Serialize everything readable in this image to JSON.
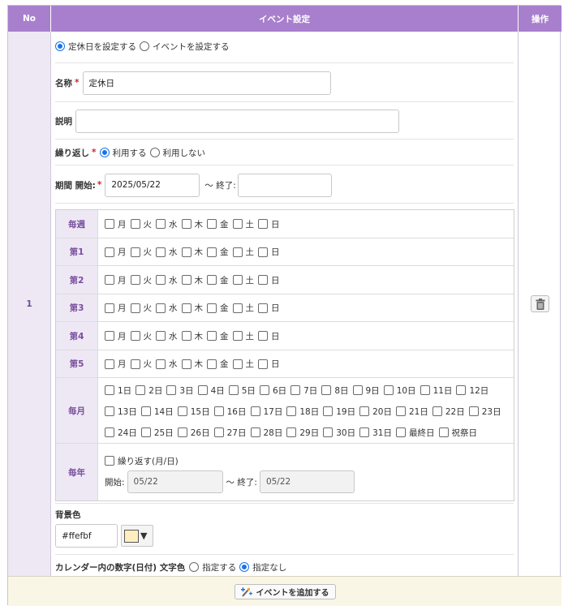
{
  "headers": {
    "no": "No",
    "event": "イベント設定",
    "ops": "操作"
  },
  "row_no": "1",
  "type_options": [
    {
      "label": "定休日を設定する",
      "selected": true
    },
    {
      "label": "イベントを設定する",
      "selected": false
    }
  ],
  "name": {
    "label": "名称",
    "required_mark": "*",
    "value": "定休日"
  },
  "description": {
    "label": "説明",
    "value": ""
  },
  "repeat": {
    "label": "繰り返し",
    "required_mark": "*",
    "options": [
      {
        "label": "利用する",
        "selected": true
      },
      {
        "label": "利用しない",
        "selected": false
      }
    ]
  },
  "period": {
    "label": "期間 開始:",
    "required_mark": "*",
    "start": "2025/05/22",
    "end_label": "〜 終了:",
    "end": ""
  },
  "weekdays": [
    "月",
    "火",
    "水",
    "木",
    "金",
    "土",
    "日"
  ],
  "week_rows": [
    "毎週",
    "第1",
    "第2",
    "第3",
    "第4",
    "第5"
  ],
  "monthly": {
    "label": "毎月",
    "days": [
      "1日",
      "2日",
      "3日",
      "4日",
      "5日",
      "6日",
      "7日",
      "8日",
      "9日",
      "10日",
      "11日",
      "12日",
      "13日",
      "14日",
      "15日",
      "16日",
      "17日",
      "18日",
      "19日",
      "20日",
      "21日",
      "22日",
      "23日",
      "24日",
      "25日",
      "26日",
      "27日",
      "28日",
      "29日",
      "30日",
      "31日",
      "最終日",
      "祝祭日"
    ]
  },
  "yearly": {
    "label": "毎年",
    "repeat_label": "繰り返す(月/日)",
    "start_label": "開始:",
    "start": "05/22",
    "end_label": "〜 終了:",
    "end": "05/22"
  },
  "bg_color": {
    "label": "背景色",
    "value": "#ffefbf",
    "swatch": "#ffefbf",
    "arrow": "▼"
  },
  "text_color": {
    "label": "カレンダー内の数字(日付) 文字色",
    "options": [
      {
        "label": "指定する",
        "selected": false
      },
      {
        "label": "指定なし",
        "selected": true
      }
    ]
  },
  "add_button": {
    "label": "イベントを追加する"
  },
  "colors": {
    "header": "#a87fcd",
    "label_cell": "#eee8f5",
    "footer": "#f9f6e6",
    "accent": "#1a73e8"
  }
}
